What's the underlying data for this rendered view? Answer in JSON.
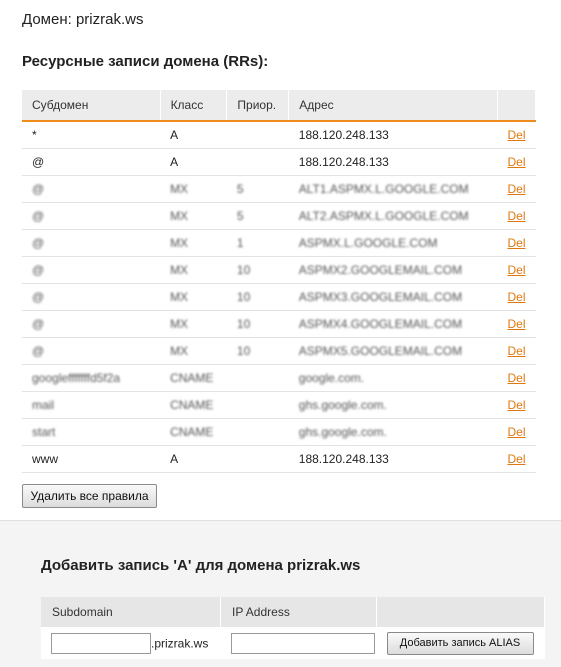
{
  "domain_title": "Домен: prizrak.ws",
  "section_title": "Ресурсные записи домена (RRs):",
  "rr_table": {
    "headers": [
      "Субдомен",
      "Класс",
      "Приор.",
      "Адрес",
      ""
    ],
    "rows": [
      {
        "sub": "*",
        "cls": "A",
        "prio": "",
        "addr": "188.120.248.133",
        "del": "Del",
        "blurred": false
      },
      {
        "sub": "@",
        "cls": "A",
        "prio": "",
        "addr": "188.120.248.133",
        "del": "Del",
        "blurred": false
      },
      {
        "sub": "@",
        "cls": "MX",
        "prio": "5",
        "addr": "ALT1.ASPMX.L.GOOGLE.COM",
        "del": "Del",
        "blurred": true
      },
      {
        "sub": "@",
        "cls": "MX",
        "prio": "5",
        "addr": "ALT2.ASPMX.L.GOOGLE.COM",
        "del": "Del",
        "blurred": true
      },
      {
        "sub": "@",
        "cls": "MX",
        "prio": "1",
        "addr": "ASPMX.L.GOOGLE.COM",
        "del": "Del",
        "blurred": true
      },
      {
        "sub": "@",
        "cls": "MX",
        "prio": "10",
        "addr": "ASPMX2.GOOGLEMAIL.COM",
        "del": "Del",
        "blurred": true
      },
      {
        "sub": "@",
        "cls": "MX",
        "prio": "10",
        "addr": "ASPMX3.GOOGLEMAIL.COM",
        "del": "Del",
        "blurred": true
      },
      {
        "sub": "@",
        "cls": "MX",
        "prio": "10",
        "addr": "ASPMX4.GOOGLEMAIL.COM",
        "del": "Del",
        "blurred": true
      },
      {
        "sub": "@",
        "cls": "MX",
        "prio": "10",
        "addr": "ASPMX5.GOOGLEMAIL.COM",
        "del": "Del",
        "blurred": true
      },
      {
        "sub": "googlefffffffd5f2a",
        "cls": "CNAME",
        "prio": "",
        "addr": "google.com.",
        "del": "Del",
        "blurred": true
      },
      {
        "sub": "mail",
        "cls": "CNAME",
        "prio": "",
        "addr": "ghs.google.com.",
        "del": "Del",
        "blurred": true
      },
      {
        "sub": "start",
        "cls": "CNAME",
        "prio": "",
        "addr": "ghs.google.com.",
        "del": "Del",
        "blurred": true
      },
      {
        "sub": "www",
        "cls": "A",
        "prio": "",
        "addr": "188.120.248.133",
        "del": "Del",
        "blurred": false
      }
    ]
  },
  "delete_all_label": "Удалить все правила",
  "add_section": {
    "title": "Добавить запись 'A' для домена prizrak.ws",
    "headers": [
      "Subdomain",
      "IP Address",
      ""
    ],
    "subdomain_value": "",
    "domain_suffix": ".prizrak.ws",
    "ip_value": "",
    "add_button_label": "Добавить запись ALIAS"
  },
  "colors": {
    "accent": "#f08c1c",
    "link": "#e07810",
    "header_bg": "#ececec"
  }
}
